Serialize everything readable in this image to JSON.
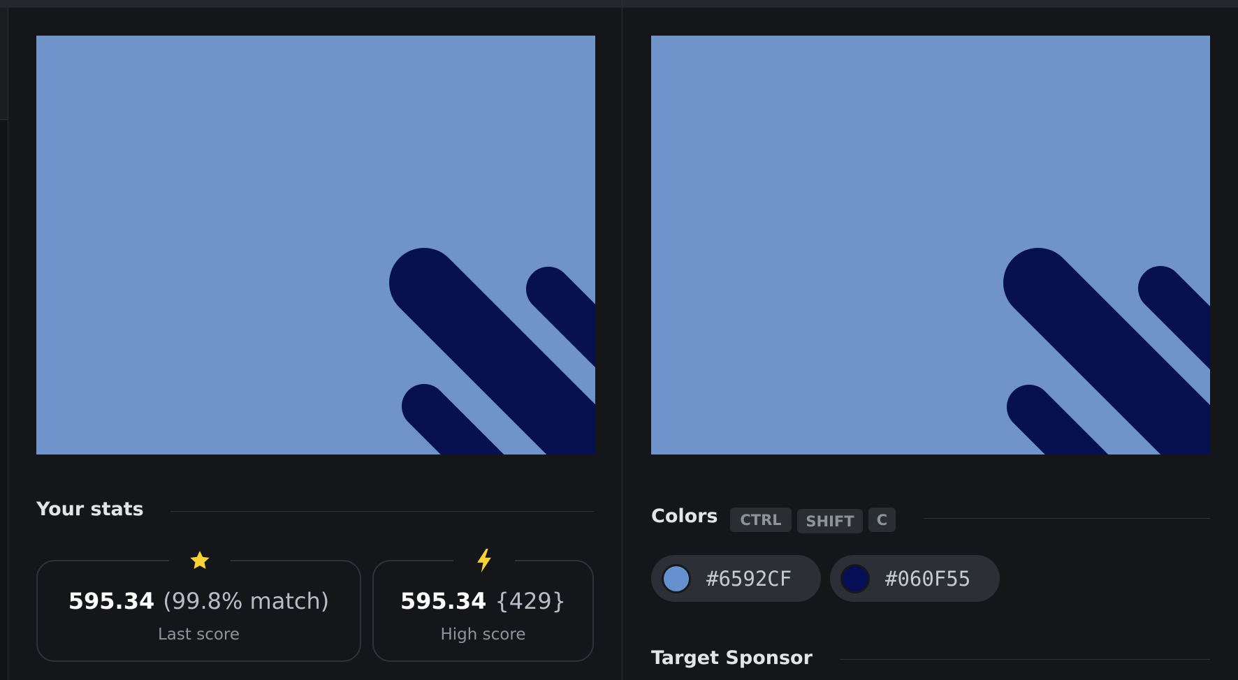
{
  "stats": {
    "title": "Your stats",
    "last": {
      "icon": "star-icon",
      "value": "595.34",
      "extra": "(99.8% match)",
      "label": "Last score"
    },
    "high": {
      "icon": "lightning-icon",
      "value": "595.34",
      "extra": "{429}",
      "label": "High score"
    }
  },
  "colors_section": {
    "title": "Colors",
    "shortcut_keys": [
      "CTRL",
      "SHIFT",
      "C"
    ],
    "swatches": [
      {
        "hex": "#6592CF",
        "color": "#6592CF"
      },
      {
        "hex": "#060F55",
        "color": "#060F55"
      }
    ]
  },
  "sponsor": {
    "title": "Target Sponsor"
  },
  "canvas_colors": {
    "background": "#6F93CA",
    "shape": "#071050"
  },
  "accent_colors": {
    "star": "#F8D236",
    "lightning": "#F8D236"
  }
}
